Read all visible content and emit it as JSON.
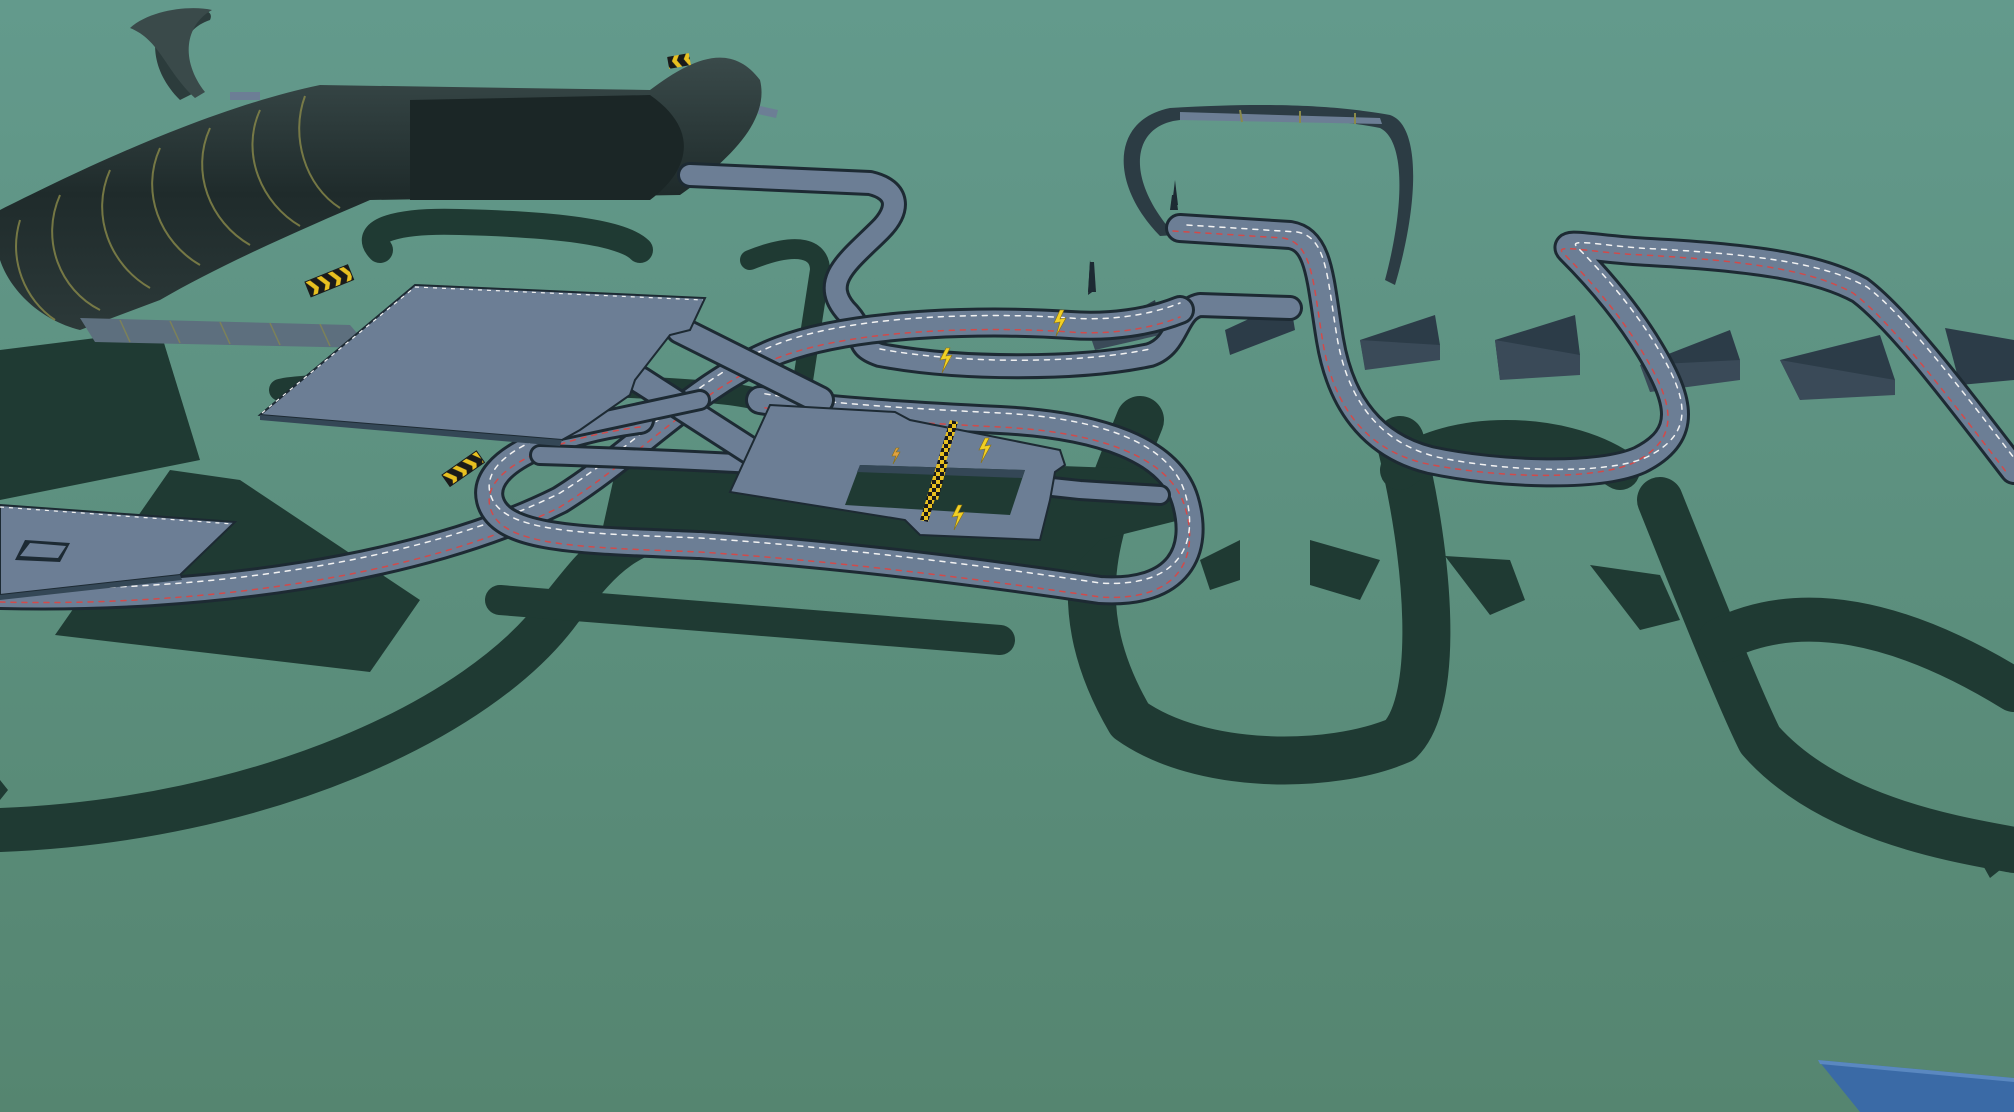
{
  "scene": {
    "description_free": true,
    "colors": {
      "sky_top": "#639a8c",
      "ground": "#558570",
      "shadow": "#1f3a33",
      "track": "#6c7e95",
      "track_edge": "#1d2a33",
      "track_side": "#344756",
      "tube": "#22302f",
      "tube_ring": "#8a8a4a",
      "lane_mark_white": "#f2f2f2",
      "lane_mark_red": "#d24a4a",
      "booster": "#f2d024",
      "chevron": "#e8c020",
      "blue_panel": "#3a6aa6"
    },
    "icons": [
      "chevron-sign-icon",
      "lightning-boost-icon",
      "checkered-gate-icon"
    ]
  }
}
